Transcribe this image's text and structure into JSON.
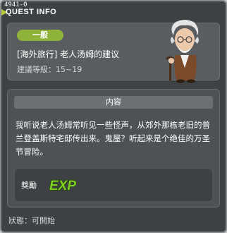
{
  "window": {
    "quest_id": "4941-0",
    "title": "QUEST INFO"
  },
  "quest": {
    "category": "一般",
    "name": "[海外旅行] 老人汤姆的建议",
    "level": "建議等級：15~19"
  },
  "content": {
    "title": "内容",
    "text": "我听说老人汤姆常听见一些怪声，从郊外那栋老旧的普兰登盖斯特宅邸传出来。鬼屋？听起来是个绝佳的万圣节冒险。"
  },
  "reward": {
    "label": "獎勵",
    "exp_text": "EXP"
  },
  "status": {
    "text": "狀態：可開始"
  },
  "colors": {
    "badge": "#8fb33a",
    "exp_green": "#7fd21f",
    "window_bg": "#3e4244"
  }
}
